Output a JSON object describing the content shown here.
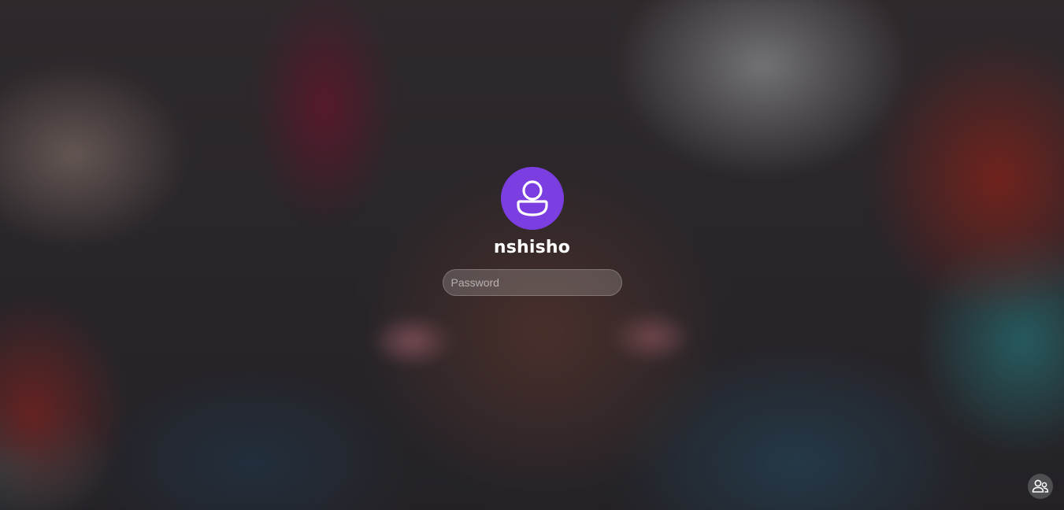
{
  "login": {
    "username": "nshisho",
    "password_placeholder": "Password",
    "avatar_icon": "user-avatar-icon",
    "avatar_color": "#7b3ee0"
  },
  "bottom_right": {
    "switch_user_icon": "switch-user-icon"
  }
}
